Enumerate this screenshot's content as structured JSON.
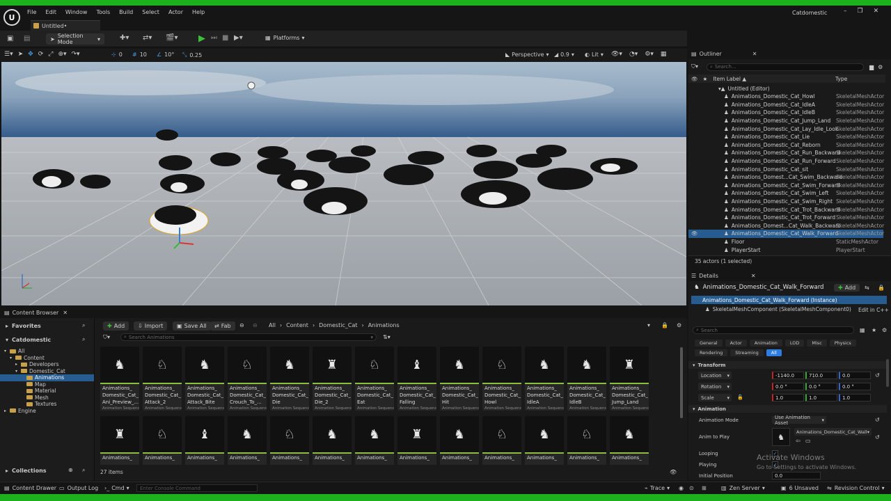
{
  "app": {
    "title": "Catdomestic",
    "menu": [
      "File",
      "Edit",
      "Window",
      "Tools",
      "Build",
      "Select",
      "Actor",
      "Help"
    ],
    "tab": "Untitled•"
  },
  "toolbar": {
    "mode": "Selection Mode",
    "platforms": "Platforms"
  },
  "viewport_bar": {
    "snap_rot": "0",
    "grid": "10",
    "angle": "10°",
    "scale": "0.25",
    "view": "Perspective",
    "fov": "0.9",
    "lit": "Lit"
  },
  "outliner": {
    "title": "Outliner",
    "search_placeholder": "Search...",
    "col_label": "Item Label ▲",
    "col_type": "Type",
    "root": "Untitled (Editor)",
    "items": [
      {
        "label": "Animations_Domestic_Cat_Howl",
        "type": "SkeletalMeshActor"
      },
      {
        "label": "Animations_Domestic_Cat_IdleA",
        "type": "SkeletalMeshActor"
      },
      {
        "label": "Animations_Domestic_Cat_IdleB",
        "type": "SkeletalMeshActor"
      },
      {
        "label": "Animations_Domestic_Cat_Jump_Land",
        "type": "SkeletalMeshActor"
      },
      {
        "label": "Animations_Domestic_Cat_Lay_Idle_Look",
        "type": "SkeletalMeshActor"
      },
      {
        "label": "Animations_Domestic_Cat_Lie",
        "type": "SkeletalMeshActor"
      },
      {
        "label": "Animations_Domestic_Cat_Reborn",
        "type": "SkeletalMeshActor"
      },
      {
        "label": "Animations_Domestic_Cat_Run_Backward",
        "type": "SkeletalMeshActor"
      },
      {
        "label": "Animations_Domestic_Cat_Run_Forward",
        "type": "SkeletalMeshActor"
      },
      {
        "label": "Animations_Domestic_Cat_sit",
        "type": "SkeletalMeshActor"
      },
      {
        "label": "Animations_Domest...Cat_Swim_Backward",
        "type": "SkeletalMeshActor"
      },
      {
        "label": "Animations_Domestic_Cat_Swim_Forward",
        "type": "SkeletalMeshActor"
      },
      {
        "label": "Animations_Domestic_Cat_Swim_Left",
        "type": "SkeletalMeshActor"
      },
      {
        "label": "Animations_Domestic_Cat_Swim_Right",
        "type": "SkeletalMeshActor"
      },
      {
        "label": "Animations_Domestic_Cat_Trot_Backward",
        "type": "SkeletalMeshActor"
      },
      {
        "label": "Animations_Domestic_Cat_Trot_Forward",
        "type": "SkeletalMeshActor"
      },
      {
        "label": "Animations_Domest...Cat_Walk_Backward",
        "type": "SkeletalMeshActor"
      },
      {
        "label": "Animations_Domestic_Cat_Walk_Forward",
        "type": "SkeletalMeshActor"
      },
      {
        "label": "Floor",
        "type": "StaticMeshActor"
      },
      {
        "label": "PlayerStart",
        "type": "PlayerStart"
      }
    ],
    "status": "35 actors (1 selected)"
  },
  "details": {
    "title": "Details",
    "actor_name": "Animations_Domestic_Cat_Walk_Forward",
    "add": "Add",
    "instance": "Animations_Domestic_Cat_Walk_Forward (Instance)",
    "component": "SkeletalMeshComponent (SkeletalMeshComponent0)",
    "edit_cpp": "Edit in C++",
    "search_placeholder": "Search",
    "tabs_row1": [
      "General",
      "Actor",
      "Animation",
      "LOD",
      "Misc",
      "Physics"
    ],
    "tabs_row2": [
      "Rendering",
      "Streaming",
      "All"
    ],
    "transform_header": "Transform",
    "location_label": "Location",
    "rotation_label": "Rotation",
    "scale_label": "Scale",
    "location": [
      "-1140.0",
      "710.0",
      "0.0"
    ],
    "rotation": [
      "0.0 °",
      "0.0 °",
      "0.0 °"
    ],
    "scale": [
      "1.0",
      "1.0",
      "1.0"
    ],
    "animation_header": "Animation",
    "anim_mode_label": "Animation Mode",
    "anim_mode": "Use Animation Asset",
    "anim_to_play_label": "Anim to Play",
    "anim_to_play": "Animations_Domestic_Cat_Wall",
    "looping": "Looping",
    "playing": "Playing",
    "initial_position": "Initial Position",
    "initial_position_value": "0.0"
  },
  "watermark": {
    "line1": "Activate Windows",
    "line2": "Go to Settings to activate Windows."
  },
  "content_browser": {
    "tab": "Content Browser",
    "favorites": "Favorites",
    "project": "Catdomestic",
    "tree": [
      "All",
      "Content",
      "Developers",
      "Domestic_Cat",
      "Animations",
      "Map",
      "Material",
      "Mesh",
      "Textures",
      "Engine"
    ],
    "collections": "Collections",
    "add": "Add",
    "import": "Import",
    "save_all": "Save All",
    "fab": "Fab",
    "path": [
      "All",
      "Content",
      "Domestic_Cat",
      "Animations"
    ],
    "search_placeholder": "Search Animations",
    "asset_type": "Animation Sequence",
    "assets_row1": [
      [
        "Animations_",
        "Domestic_Cat_",
        "Ani_Preview_..."
      ],
      [
        "Animations_",
        "Domestic_Cat_",
        "Attack_2"
      ],
      [
        "Animations_",
        "Domestic_Cat_",
        "Attack_Bite"
      ],
      [
        "Animations_",
        "Domestic_Cat_",
        "Crouch_To_..."
      ],
      [
        "Animations_",
        "Domestic_Cat_",
        "Die"
      ],
      [
        "Animations_",
        "Domestic_Cat_",
        "Die_2"
      ],
      [
        "Animations_",
        "Domestic_Cat_",
        "Eat"
      ],
      [
        "Animations_",
        "Domestic_Cat_",
        "Falling"
      ],
      [
        "Animations_",
        "Domestic_Cat_",
        "Hit"
      ],
      [
        "Animations_",
        "Domestic_Cat_",
        "Howl"
      ],
      [
        "Animations_",
        "Domestic_Cat_",
        "IdleA"
      ],
      [
        "Animations_",
        "Domestic_Cat_",
        "IdleB"
      ],
      [
        "Animations_",
        "Domestic_Cat_",
        "Jump_Land"
      ]
    ],
    "assets_row2": [
      "Animations_",
      "Animations_",
      "Animations_",
      "Animations_",
      "Animations_",
      "Animations_",
      "Animations_",
      "Animations_",
      "Animations_",
      "Animations_",
      "Animations_",
      "Animations_",
      "Animations_"
    ],
    "count": "27 items"
  },
  "statusbar": {
    "content_drawer": "Content Drawer",
    "output_log": "Output Log",
    "cmd": "Cmd",
    "console_placeholder": "Enter Console Command",
    "trace": "Trace",
    "zen": "Zen Server",
    "unsaved": "6 Unsaved",
    "revision": "Revision Control"
  }
}
